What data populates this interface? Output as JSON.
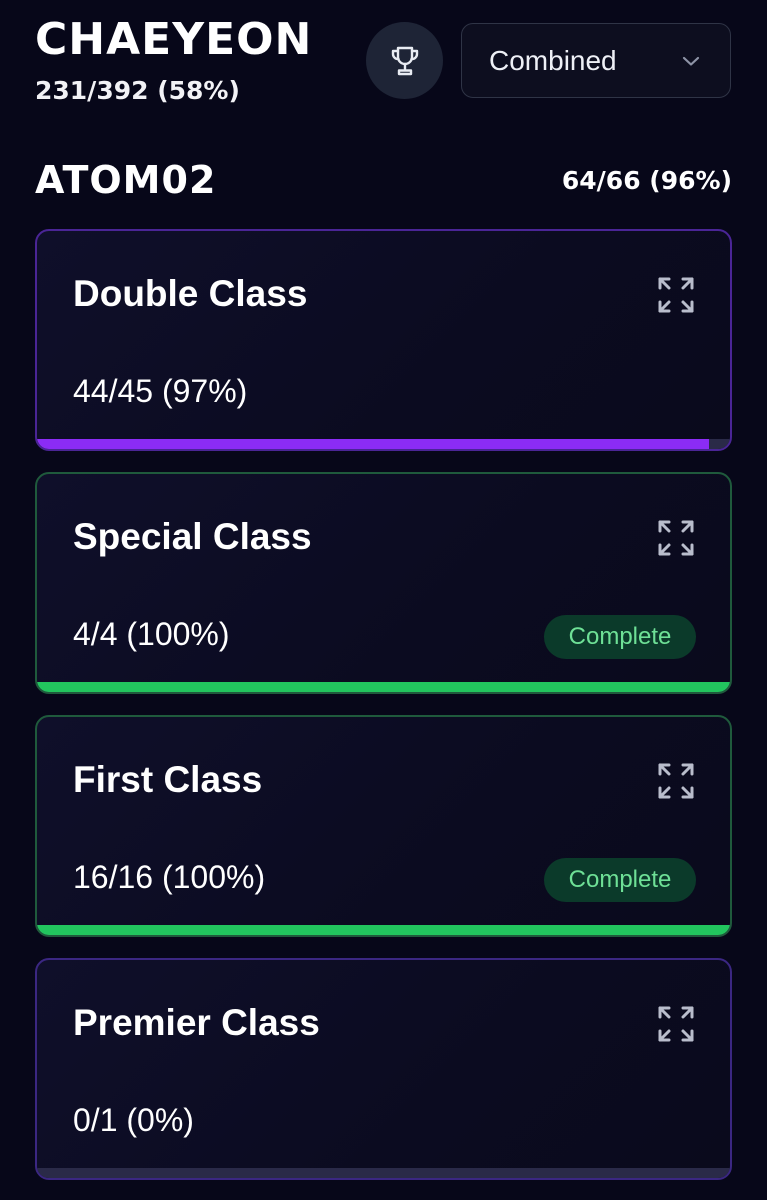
{
  "member": {
    "name": "CHAEYEON",
    "progress": "231/392 (58%)"
  },
  "icons": {
    "trophy": "trophy-icon",
    "dropdown": "chevron-down-icon",
    "expand": "expand-icon"
  },
  "filter": {
    "selected": "Combined"
  },
  "section": {
    "title": "ATOM02",
    "progress": "64/66 (96%)"
  },
  "colors": {
    "background": "#070719",
    "purple": "#8b2cf5",
    "green": "#22c55e",
    "badge_bg": "#0b3a2a",
    "badge_text": "#6ee096"
  },
  "cards": [
    {
      "title": "Double Class",
      "progress": "44/45 (97%)",
      "fill": 0.97,
      "status": "",
      "color": "#8b2cf5",
      "border": "#4a2596"
    },
    {
      "title": "Special Class",
      "progress": "4/4 (100%)",
      "fill": 1.0,
      "status": "Complete",
      "color": "#22c55e",
      "border": "#1f5a3c"
    },
    {
      "title": "First Class",
      "progress": "16/16 (100%)",
      "fill": 1.0,
      "status": "Complete",
      "color": "#22c55e",
      "border": "#1f5a3c"
    },
    {
      "title": "Premier Class",
      "progress": "0/1 (0%)",
      "fill": 0.0,
      "status": "",
      "color": "#8b2cf5",
      "border": "#3b2782"
    }
  ]
}
